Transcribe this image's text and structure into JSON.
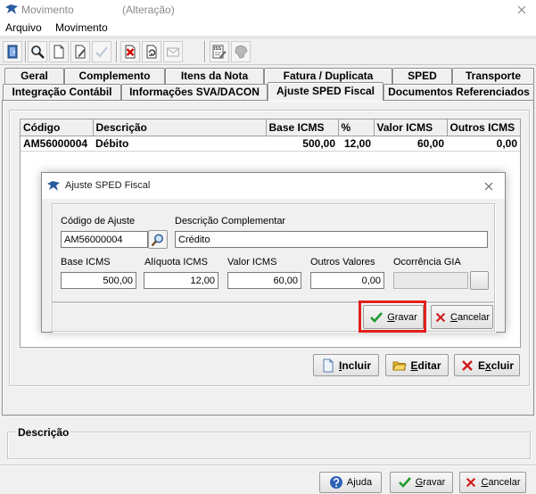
{
  "window": {
    "title": "Movimento",
    "subtitle": "(Alteração)"
  },
  "menu": {
    "items": [
      {
        "label": "Arquivo"
      },
      {
        "label": "Movimento"
      }
    ]
  },
  "toolbar": {
    "icons": [
      "exit-icon",
      "search-icon",
      "new-page-icon",
      "edit-page-icon",
      "check-icon",
      "delete-page-icon",
      "refresh-icon",
      "envelope-icon",
      "iss-icon",
      "map-icon"
    ],
    "iss_label": "ISS"
  },
  "tabs": {
    "row1": [
      {
        "label": "Geral"
      },
      {
        "label": "Complemento"
      },
      {
        "label": "Itens da Nota"
      },
      {
        "label": "Fatura / Duplicata"
      },
      {
        "label": "SPED"
      },
      {
        "label": "Transporte"
      }
    ],
    "row2": [
      {
        "label": "Integração Contábil"
      },
      {
        "label": "Informações SVA/DACON"
      },
      {
        "label": "Ajuste SPED Fiscal",
        "active": true
      },
      {
        "label": "Documentos Referenciados"
      }
    ]
  },
  "grid": {
    "columns": [
      "Código",
      "Descrição",
      "Base ICMS",
      "%",
      "Valor ICMS",
      "Outros ICMS"
    ],
    "rows": [
      [
        "AM56000004",
        "Débito",
        "500,00",
        "12,00",
        "60,00",
        "0,00"
      ]
    ]
  },
  "modal": {
    "title": "Ajuste SPED Fiscal",
    "codigo_ajuste": {
      "label": "Código de Ajuste",
      "value": "AM56000004"
    },
    "descricao_complementar": {
      "label": "Descrição Complementar",
      "value": "Crédito"
    },
    "base_icms": {
      "label": "Base ICMS",
      "value": "500,00"
    },
    "aliquota_icms": {
      "label": "Alíquota ICMS",
      "value": "12,00"
    },
    "valor_icms": {
      "label": "Valor ICMS",
      "value": "60,00"
    },
    "outros_valores": {
      "label": "Outros Valores",
      "value": "0,00"
    },
    "ocorrencia_gia": {
      "label": "Ocorrência GIA",
      "value": ""
    },
    "save_label": "Gravar",
    "cancel_label": "Cancelar"
  },
  "list_actions": {
    "add_label": "Incluir",
    "edit_label": "Editar",
    "delete_label": "Excluir"
  },
  "description_group": {
    "label": "Descrição"
  },
  "footer": {
    "help_label": "Ajuda",
    "save_label": "Gravar",
    "cancel_label": "Cancelar"
  },
  "colors": {
    "highlight": "#e3201b",
    "save_check": "#1e9b2e",
    "cancel_red": "#d11a1a"
  }
}
